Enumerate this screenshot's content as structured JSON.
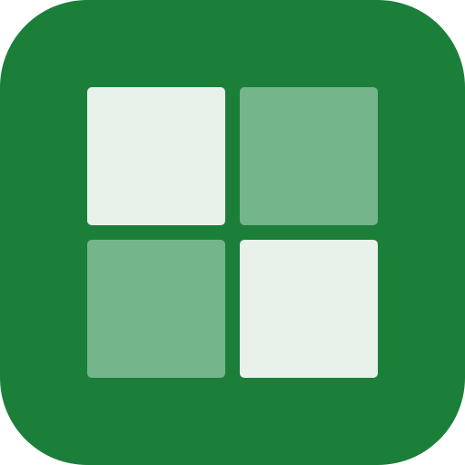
{
  "icon": {
    "name": "grid-app-icon",
    "background_color": "#1b7f3a",
    "tiles": [
      {
        "name": "tile-top-left",
        "color": "#e8f2ea"
      },
      {
        "name": "tile-top-right",
        "color": "#74b58b"
      },
      {
        "name": "tile-bottom-left",
        "color": "#74b58b"
      },
      {
        "name": "tile-bottom-right",
        "color": "#e8f2ea"
      }
    ]
  }
}
